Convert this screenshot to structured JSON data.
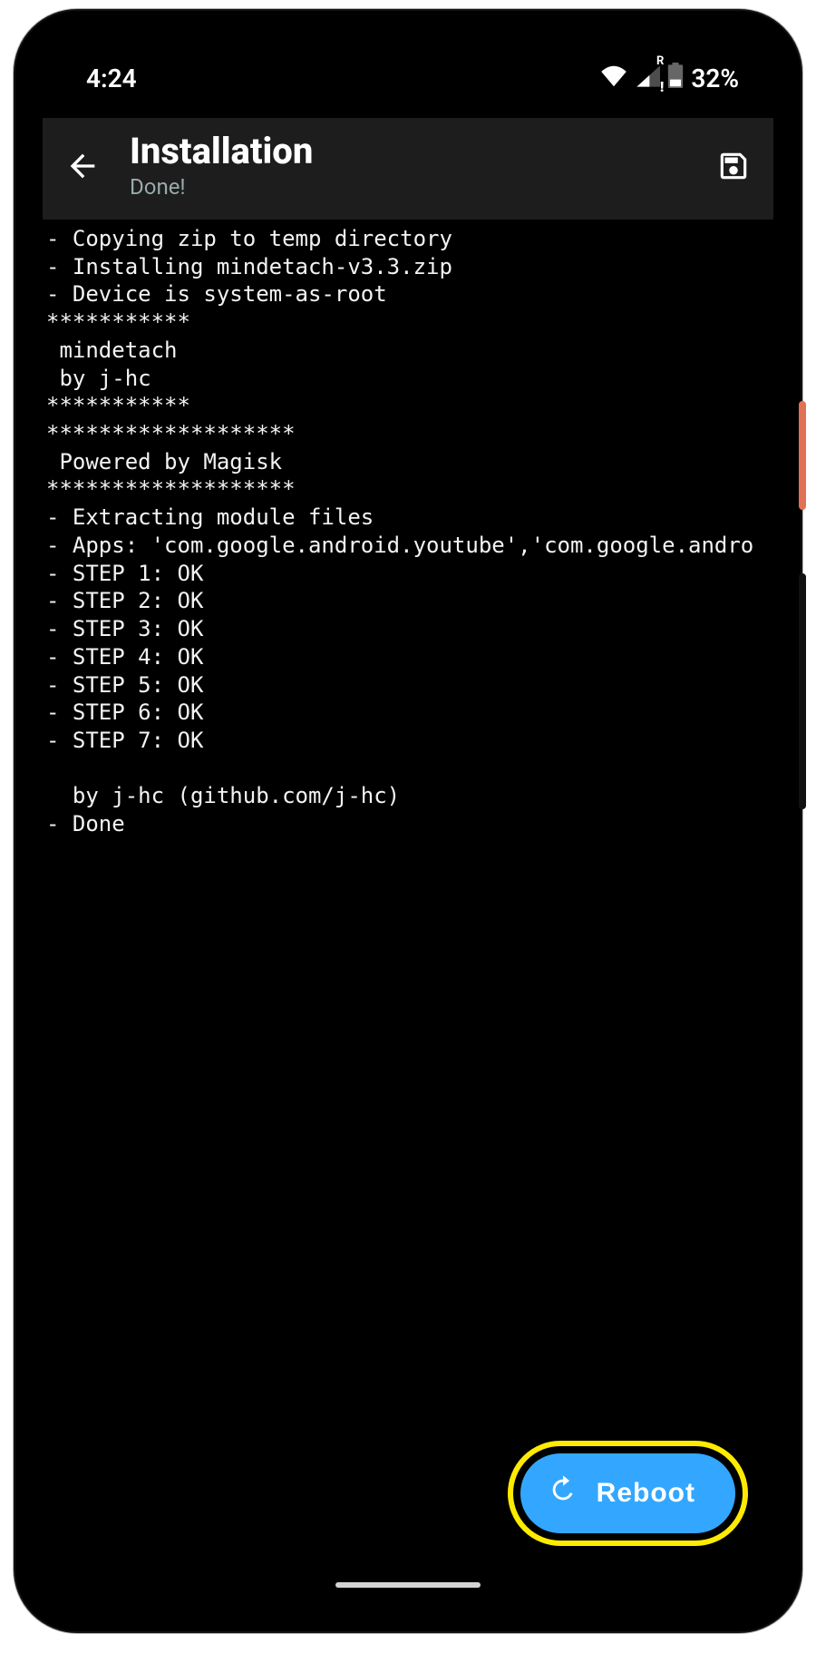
{
  "statusbar": {
    "time": "4:24",
    "roaming_badge": "R",
    "battery_text": "32%"
  },
  "appbar": {
    "title": "Installation",
    "subtitle": "Done!"
  },
  "console_lines": [
    "- Copying zip to temp directory",
    "- Installing mindetach-v3.3.zip",
    "- Device is system-as-root",
    "***********",
    " mindetach",
    " by j-hc",
    "***********",
    "*******************",
    " Powered by Magisk",
    "*******************",
    "- Extracting module files",
    "- Apps: 'com.google.android.youtube','com.google.andro",
    "- STEP 1: OK",
    "- STEP 2: OK",
    "- STEP 3: OK",
    "- STEP 4: OK",
    "- STEP 5: OK",
    "- STEP 6: OK",
    "- STEP 7: OK",
    "",
    "  by j-hc (github.com/j-hc)",
    "- Done"
  ],
  "fab": {
    "label": "Reboot"
  }
}
